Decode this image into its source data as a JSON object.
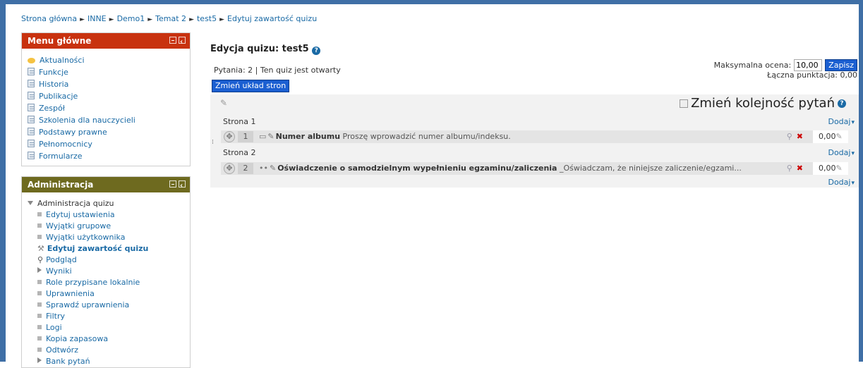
{
  "breadcrumb": {
    "items": [
      "Strona główna",
      "INNE",
      "Demo1",
      "Temat 2",
      "test5",
      "Edytuj zawartość quizu"
    ],
    "separator": "►"
  },
  "menu_glowne": {
    "title": "Menu główne",
    "header_color": "#c8320f",
    "items": [
      "Aktualności",
      "Funkcje",
      "Historia",
      "Publikacje",
      "Zespół",
      "Szkolenia dla nauczycieli",
      "Podstawy prawne",
      "Pełnomocnicy",
      "Formularze"
    ]
  },
  "administracja": {
    "title": "Administracja",
    "header_color": "#6e6a1f",
    "items": [
      "Administracja quizu",
      "Edytuj ustawienia",
      "Wyjątki grupowe",
      "Wyjątki użytkownika",
      "Edytuj zawartość quizu",
      "Podgląd",
      "Wyniki",
      "Role przypisane lokalnie",
      "Uprawnienia",
      "Sprawdź uprawnienia",
      "Filtry",
      "Logi",
      "Kopia zapasowa",
      "Odtwórz",
      "Bank pytań"
    ]
  },
  "main": {
    "title": "Edycja quizu: test5",
    "info": "Pytania: 2 | Ten quiz jest otwarty",
    "repaginate_label": "Zmień układ stron",
    "max_grade_label": "Maksymalna ocena:",
    "max_grade_value": "10,00",
    "save_label": "Zapisz",
    "total_points": "Łączna punktacja: 0,00",
    "reorder_label": "Zmień kolejność pytań",
    "add_label": "Dodaj",
    "pages": [
      {
        "label": "Strona 1",
        "question": {
          "number": "1",
          "name": "Numer albumu",
          "text": "Proszę wprowadzić numer albumu/indeksu.",
          "mark": "0,00"
        }
      },
      {
        "label": "Strona 2",
        "question": {
          "number": "2",
          "name": "Oświadczenie o samodzielnym wypełnieniu egzaminu/zaliczenia",
          "text": "_Oświadczam, że niniejsze zaliczenie/egzami...",
          "mark": "0,00"
        }
      }
    ]
  },
  "colors": {
    "frame": "#3f6fa6",
    "link": "#1a6aa5",
    "button": "#1b5fd1",
    "delete": "#cc0000"
  }
}
